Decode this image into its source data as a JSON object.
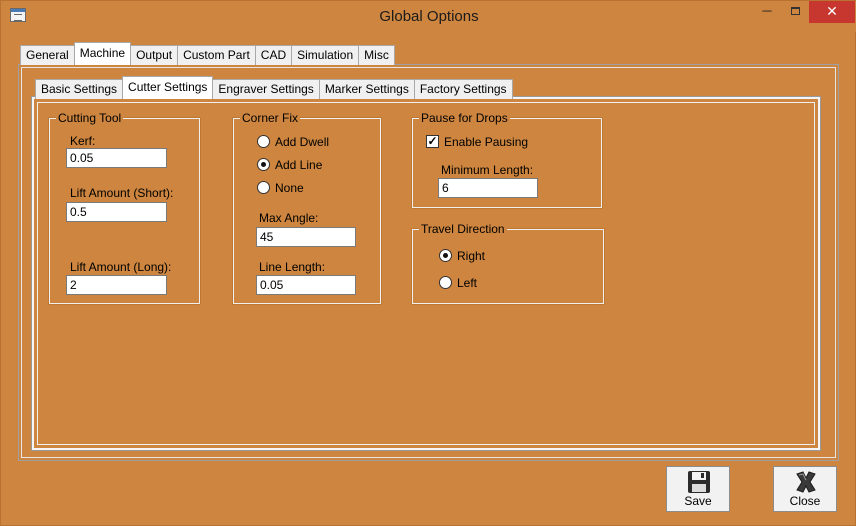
{
  "window": {
    "title": "Global Options"
  },
  "titlebar": {
    "minimize": "─",
    "close": "✕"
  },
  "outer_tabs": [
    "General",
    "Machine",
    "Output",
    "Custom Part",
    "CAD",
    "Simulation",
    "Misc"
  ],
  "inner_tabs": [
    "Basic Settings",
    "Cutter Settings",
    "Engraver Settings",
    "Marker Settings",
    "Factory Settings"
  ],
  "cutting_tool": {
    "title": "Cutting Tool",
    "kerf_label": "Kerf:",
    "kerf_value": "0.05",
    "lift_short_label": "Lift Amount (Short):",
    "lift_short_value": "0.5",
    "lift_long_label": "Lift Amount (Long):",
    "lift_long_value": "2"
  },
  "corner_fix": {
    "title": "Corner Fix",
    "options": [
      "Add Dwell",
      "Add Line",
      "None"
    ],
    "selected": "Add Line",
    "max_angle_label": "Max Angle:",
    "max_angle_value": "45",
    "line_length_label": "Line Length:",
    "line_length_value": "0.05"
  },
  "pause_for_drops": {
    "title": "Pause for Drops",
    "enable_label": "Enable Pausing",
    "enabled": true,
    "check_glyph": "✓",
    "min_length_label": "Minimum Length:",
    "min_length_value": "6"
  },
  "travel_direction": {
    "title": "Travel Direction",
    "options": [
      "Right",
      "Left"
    ],
    "selected": "Right"
  },
  "buttons": {
    "save": "Save",
    "close": "Close"
  },
  "icons": {
    "save": "save-disk-icon",
    "close": "close-x-icon"
  }
}
